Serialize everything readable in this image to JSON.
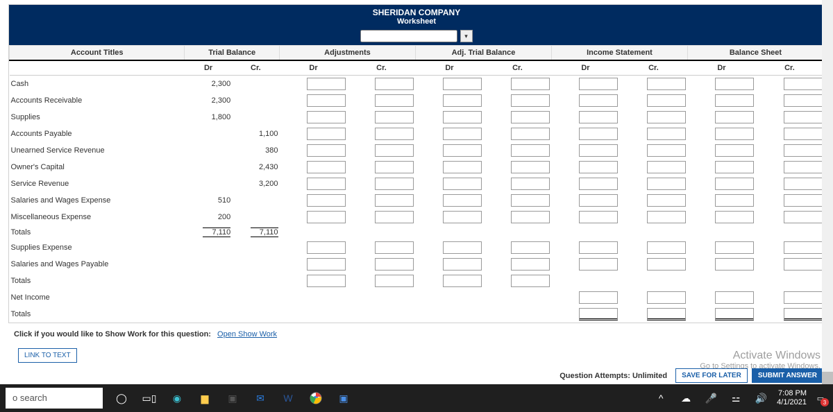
{
  "header": {
    "company": "SHERIDAN COMPANY",
    "subtitle": "Worksheet"
  },
  "columns": {
    "account": "Account Titles",
    "groups": [
      "Trial Balance",
      "Adjustments",
      "Adj. Trial Balance",
      "Income Statement",
      "Balance Sheet"
    ],
    "dr": "Dr",
    "cr": "Cr."
  },
  "rows": [
    {
      "label": "Cash",
      "tb_dr": "2,300",
      "tb_cr": "",
      "inputs": 8
    },
    {
      "label": "Accounts Receivable",
      "tb_dr": "2,300",
      "tb_cr": "",
      "inputs": 8
    },
    {
      "label": "Supplies",
      "tb_dr": "1,800",
      "tb_cr": "",
      "inputs": 8
    },
    {
      "label": "Accounts Payable",
      "tb_dr": "",
      "tb_cr": "1,100",
      "inputs": 8
    },
    {
      "label": "Unearned Service Revenue",
      "tb_dr": "",
      "tb_cr": "380",
      "inputs": 8
    },
    {
      "label": "Owner's Capital",
      "tb_dr": "",
      "tb_cr": "2,430",
      "inputs": 8
    },
    {
      "label": "Service Revenue",
      "tb_dr": "",
      "tb_cr": "3,200",
      "inputs": 8
    },
    {
      "label": "Salaries and Wages Expense",
      "tb_dr": "510",
      "tb_cr": "",
      "inputs": 8
    },
    {
      "label": "Miscellaneous Expense",
      "tb_dr": "200",
      "tb_cr": "",
      "inputs": 8
    },
    {
      "label": "Totals",
      "indent": true,
      "tb_dr": "7,110",
      "tb_cr": "7,110",
      "totals_line": true,
      "inputs": 0
    },
    {
      "label": "Supplies Expense",
      "tb_dr": "",
      "tb_cr": "",
      "inputs": 8
    },
    {
      "label": "Salaries and Wages Payable",
      "tb_dr": "",
      "tb_cr": "",
      "inputs": 8
    },
    {
      "label": "Totals",
      "indent": true,
      "tb_dr": "",
      "tb_cr": "",
      "inputs_adj_subtotal": true
    },
    {
      "label": "Net Income",
      "tb_dr": "",
      "tb_cr": "",
      "inputs_is_bs": 4
    },
    {
      "label": "Totals",
      "indent": true,
      "tb_dr": "",
      "tb_cr": "",
      "inputs_is_bs": 4,
      "double": true
    }
  ],
  "show_work": {
    "label": "Click if you would like to Show Work for this question:",
    "link": "Open Show Work"
  },
  "link_to_text": "LINK TO TEXT",
  "footer": {
    "attempts": "Question Attempts: Unlimited",
    "save": "SAVE FOR LATER",
    "submit": "SUBMIT ANSWER"
  },
  "watermark": {
    "title": "Activate Windows",
    "sub": "Go to Settings to activate Windows."
  },
  "taskbar": {
    "search_placeholder": "o search",
    "time": "7:08 PM",
    "date": "4/1/2021",
    "notif_count": "3"
  }
}
